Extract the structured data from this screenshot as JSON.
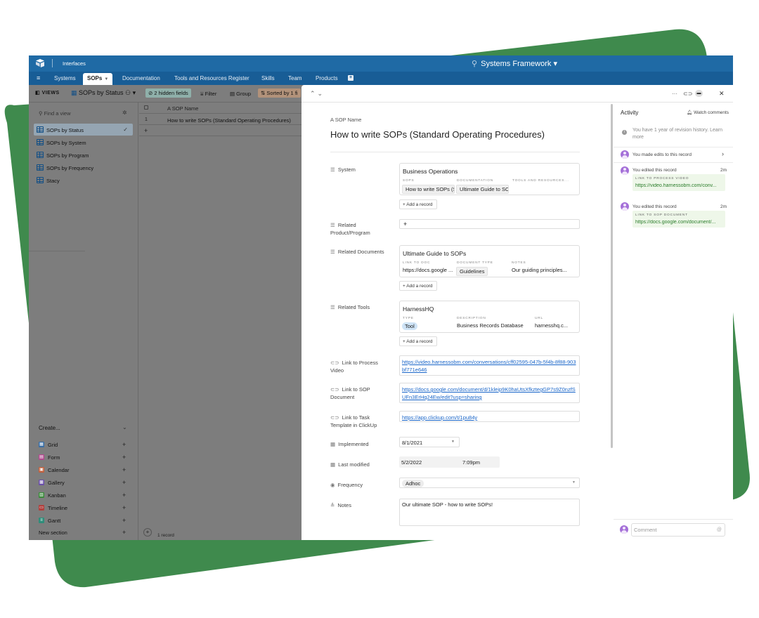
{
  "topbar": {
    "interfaces_label": "Interfaces",
    "base_title": "Systems Framework",
    "base_title_caret": "▾"
  },
  "tabs": [
    {
      "label": "Systems"
    },
    {
      "label": "SOPs"
    },
    {
      "label": "Documentation"
    },
    {
      "label": "Tools and Resources Register"
    },
    {
      "label": "Skills"
    },
    {
      "label": "Team"
    },
    {
      "label": "Products"
    }
  ],
  "viewbar": {
    "views_label": "VIEWS",
    "current_view": "SOPs by Status",
    "hidden_fields": "2 hidden fields",
    "filter": "Filter",
    "group": "Group",
    "sorted": "Sorted by 1 fi"
  },
  "sidebar": {
    "find_placeholder": "Find a view",
    "views": [
      {
        "label": "SOPs by Status"
      },
      {
        "label": "SOPs by System"
      },
      {
        "label": "SOPs by Program"
      },
      {
        "label": "SOPs by Frequency"
      },
      {
        "label": "Stacy"
      }
    ],
    "create_label": "Create...",
    "create_items": [
      {
        "label": "Grid",
        "color": "#3a6ea5",
        "icon": "grid-icon"
      },
      {
        "label": "Form",
        "color": "#b04a8e",
        "icon": "form-icon"
      },
      {
        "label": "Calendar",
        "color": "#c0603d",
        "icon": "calendar-icon"
      },
      {
        "label": "Gallery",
        "color": "#6a4fa8",
        "icon": "gallery-icon"
      },
      {
        "label": "Kanban",
        "color": "#3b8a3b",
        "icon": "kanban-icon"
      },
      {
        "label": "Timeline",
        "color": "#b0413e",
        "icon": "timeline-icon"
      },
      {
        "label": "Gantt",
        "color": "#2f8d7a",
        "icon": "gantt-icon"
      }
    ],
    "new_section": "New section"
  },
  "grid": {
    "column_header": "SOP Name",
    "rows": [
      {
        "num": "1",
        "name": "How to write SOPs (Standard Operating Procedures)"
      }
    ],
    "record_count": "1 record"
  },
  "record": {
    "name_label": "SOP Name",
    "title": "How to write SOPs (Standard Operating Procedures)",
    "system": {
      "label": "System",
      "card_title": "Business Operations",
      "headers": [
        "SOPS",
        "DOCUMENTATION",
        "TOOLS AND RESOURCES..."
      ],
      "values": [
        "How to write SOPs (St",
        "Ultimate Guide to SOP",
        ""
      ]
    },
    "add_record": "+ Add a record",
    "related_product": {
      "label": "Related Product/Program",
      "value": "+"
    },
    "related_documents": {
      "label": "Related Documents",
      "card_title": "Ultimate Guide to SOPs",
      "headers": [
        "LINK TO DOC",
        "DOCUMENT TYPE",
        "NOTES"
      ],
      "values": [
        "https://docs.google ...",
        "Guidelines",
        "Our guiding principles..."
      ]
    },
    "related_tools": {
      "label": "Related Tools",
      "card_title": "HarnessHQ",
      "headers": [
        "TYPE",
        "DESCRIPTION",
        "URL"
      ],
      "values": [
        "Tool",
        "Business Records Database",
        "harnesshq.c..."
      ]
    },
    "process_video": {
      "label": "Link to Process Video",
      "value": "https://video.harnessobm.com/conversations/cff02595-047b-5f4b-8f88-903bf771e646"
    },
    "sop_document": {
      "label": "Link to SOP Document",
      "value": "https://docs.google.com/document/d/1kleip9K0haUtsXfkztegGP7s9Z0nzfSUFn3ErHq24Ew/edit?usp=sharing"
    },
    "task_template": {
      "label": "Link to Task Template in ClickUp",
      "value": "https://app.clickup.com/t/1pu84y"
    },
    "implemented": {
      "label": "Implemented",
      "value": "8/1/2021"
    },
    "last_modified": {
      "label": "Last modified",
      "date": "5/2/2022",
      "time": "7:09pm"
    },
    "frequency": {
      "label": "Frequency",
      "value": "Adhoc"
    },
    "notes": {
      "label": "Notes",
      "value": "Our ultimate SOP - how to write SOPs!"
    }
  },
  "activity": {
    "title": "Activity",
    "watch": "Watch comments",
    "revision_info": "You have 1 year of revision history. Learn more",
    "entries": [
      {
        "text": "You made edits to this record",
        "time": ""
      },
      {
        "text": "You edited this record",
        "time": "2m",
        "field": "LINK TO PROCESS VIDEO",
        "value": "https://video.harnessobm.com/conv..."
      },
      {
        "text": "You edited this record",
        "time": "2m",
        "field": "LINK TO SOP DOCUMENT",
        "value": "https://docs.google.com/document/..."
      }
    ],
    "comment_placeholder": "Comment",
    "comment_at": "@"
  },
  "colors": {
    "brand_green": "#3f8a4d",
    "topbar_blue": "#1f6aa5",
    "tabbar_blue": "#185d96",
    "link_blue": "#1a66c9",
    "avatar_purple": "#a46fd8"
  }
}
